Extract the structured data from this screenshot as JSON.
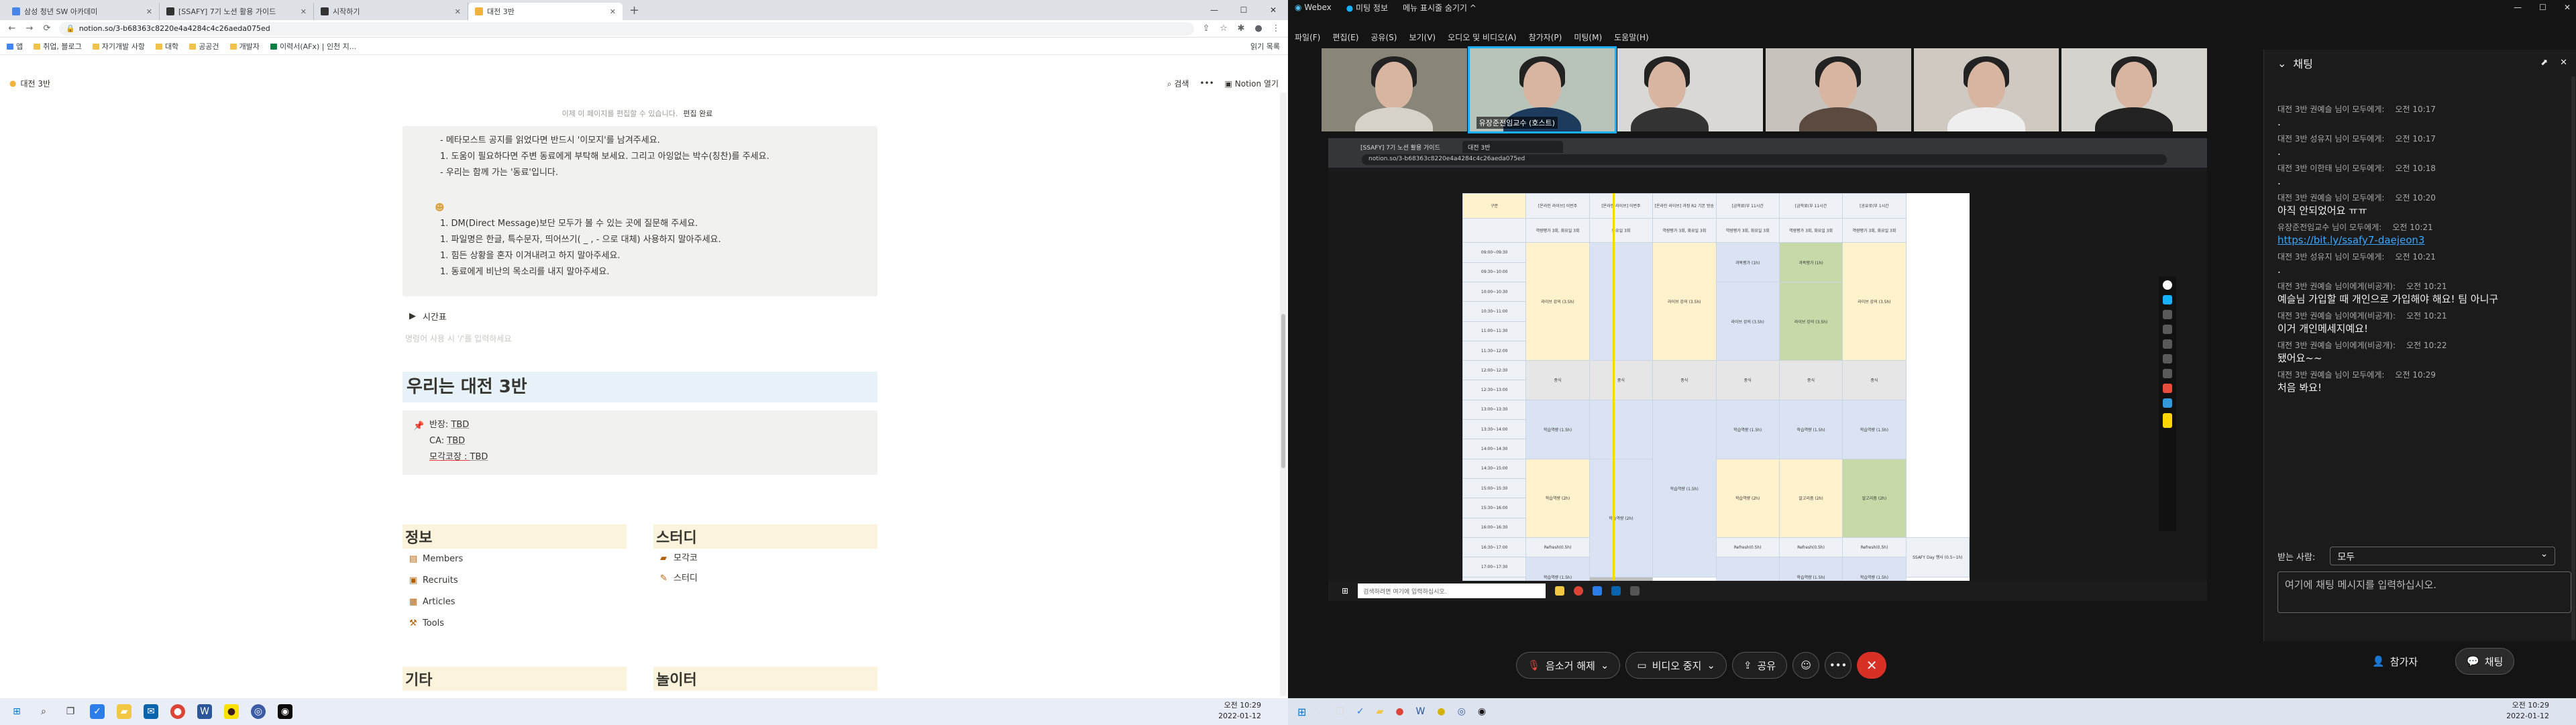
{
  "left": {
    "tabs": [
      {
        "label": "삼성 청년 SW 아카데미"
      },
      {
        "label": "[SSAFY] 7기 노션 활용 가이드"
      },
      {
        "label": "시작하기"
      },
      {
        "label": "대전 3반"
      }
    ],
    "url": "notion.so/3-b68363c8220e4a4284c4c26aeda075ed",
    "bookmarks": [
      "앱",
      "취업, 블로그",
      "자기개발 사항",
      "대학",
      "공공건",
      "개발자",
      "이력서(AFx) | 인천 지..."
    ],
    "bookmarks_right": "읽기 목록",
    "page_title": "대전 3반",
    "top_actions": {
      "search": "검색",
      "more": "•••",
      "open": "Notion 열기"
    },
    "banner": {
      "text": "이제 이 페이지를 편집할 수 있습니다.",
      "done": "편집 완료"
    },
    "callout_lines": [
      "- 메타모스트 공지를 읽었다면 반드시 '이모지'를 남겨주세요.",
      "1. 도움이 필요하다면 주변 동료에게 부탁해 보세요. 그리고 아잉없는 박수(칭찬)를 주세요.",
      "- 우리는 함께 가는 '동료'입니다."
    ],
    "callout_lines2": [
      "1. DM(Direct Message)보단 모두가 볼 수 있는 곳에 질문해 주세요.",
      "1. 파일명은 한글, 특수문자, 띄어쓰기( _ , - 으로 대체) 사용하지 말아주세요.",
      "1. 힘든 상황을 혼자 이겨내려고 하지 말아주세요.",
      "1. 동료에게 비난의 목소리를 내지 말아주세요."
    ],
    "toggle_label": "시간표",
    "hint": "명령어 사용 시 '/'를 입력하세요",
    "heading": "우리는 대전 3반",
    "info": [
      {
        "k": "반장: ",
        "v": "TBD"
      },
      {
        "k": "CA: ",
        "v": "TBD"
      },
      {
        "k": "모각코장 : ",
        "v": "TBD"
      }
    ],
    "sec_info": {
      "title": "정보",
      "items": [
        "Members",
        "Recruits",
        "Articles",
        "Tools"
      ]
    },
    "sec_study": {
      "title": "스터디",
      "items": [
        "모각코",
        "스터디"
      ]
    },
    "sec_etc": {
      "title": "기타"
    },
    "sec_play": {
      "title": "놀이터"
    },
    "clock": {
      "time": "오전 10:29",
      "date": "2022-01-12"
    }
  },
  "right": {
    "menubar": [
      "Webex",
      "미팅 정보",
      "메뉴 표시줄 숨기기 ^"
    ],
    "menu": [
      "파일(F)",
      "편집(E)",
      "공유(S)",
      "보기(V)",
      "오디오 및 비디오(A)",
      "참가자(P)",
      "미팅(M)",
      "도움말(H)"
    ],
    "presenter_label": "유장준전임교수 (호스트)",
    "share_tabs": [
      "[SSAFY] 7기 노션 활용 가이드",
      "대전 3반"
    ],
    "share_url": "notion.so/3-b68363c8220e4a4284c4c26aeda075ed",
    "taskbar_search": "검색하려면 여기에 입력하십시오.",
    "tt_headers": [
      "구분",
      "[온라인 라이브] 이번주",
      "[온라인 라이브] 이번주",
      "[온라인 라이브] 과정 R2 기본 방송",
      "[금학료(부 11시간",
      "[금학료(부 11시간",
      "[공유로(부 1시간"
    ],
    "tt_sub": [
      "",
      "역량평가 3회, 화요일 3회",
      "화요일 3회",
      "역량평가 3회, 화요일 3회",
      "역량평가 3회, 화요일 3회",
      "역량평가 3회, 화요일 3회",
      "역량평가 3회, 화요일 3회"
    ],
    "tt_times": [
      "09:00~09:30",
      "09:30~10:00",
      "10:00~10:30",
      "10:30~11:00",
      "11:00~11:30",
      "11:30~12:00",
      "12:00~12:30",
      "12:30~13:00",
      "13:00~13:30",
      "13:30~14:00",
      "14:00~14:30",
      "14:30~15:00",
      "15:00~15:30",
      "15:30~16:00",
      "16:00~16:30",
      "16:30~17:00",
      "17:00~17:30",
      "17:30~18:00"
    ],
    "tt_cells": {
      "live": "라이브 강의 (3.5h)",
      "lunch": "중식",
      "self": "학습역량 (1.5h)",
      "refresh": "Refresh(0.5h)",
      "quiz": "과목평가 (1h)",
      "meet": "학습역량 (2h)",
      "algo": "알고리즘 (2h)",
      "ssafy": "SSAFY Day 행사 (0.5~1h)"
    },
    "controls": {
      "mute": "음소거 해제",
      "video": "비디오 중지",
      "share": "공유",
      "participants": "참가자",
      "chat": "채팅"
    },
    "chat": {
      "title": "채팅",
      "messages": [
        {
          "who": "대전 3반 권예슬 님이 모두에게:",
          "time": "오전 10:17",
          "text": "."
        },
        {
          "who": "대전 3반 성유지 님이 모두에게:",
          "time": "오전 10:17",
          "text": "."
        },
        {
          "who": "대전 3반 이한태 님이 모두에게:",
          "time": "오전 10:18",
          "text": "."
        },
        {
          "who": "대전 3반 권예슬 님이 모두에게:",
          "time": "오전 10:20",
          "text": "아직 안되었어요 ㅠㅠ"
        },
        {
          "who": "유장준전임교수 님이 모두에게:",
          "time": "오전 10:21",
          "text": "https://bit.ly/ssafy7-daejeon3",
          "link": true
        },
        {
          "who": "대전 3반 성유지 님이 모두에게:",
          "time": "오전 10:21",
          "text": "."
        },
        {
          "who": "대전 3반 권예슬 님이에게(비공개):",
          "time": "오전 10:21",
          "text": "예슬님 가입할 때 개인으로 가입해야 해요! 팀 아니구"
        },
        {
          "who": "대전 3반 권예슬 님이에게(비공개):",
          "time": "오전 10:21",
          "text": "이거 개인메세지예요!"
        },
        {
          "who": "대전 3반 권예슬 님이에게(비공개):",
          "time": "오전 10:22",
          "text": "됐어요~~"
        },
        {
          "who": "대전 3반 권예슬 님이 모두에게:",
          "time": "오전 10:29",
          "text": "처음 봐요!"
        }
      ],
      "recipient_label": "받는 사람:",
      "recipient": "모두",
      "placeholder": "여기에 채팅 메시지를 입력하십시오."
    },
    "clock": {
      "time": "오전 10:29",
      "date": "2022-01-12"
    }
  }
}
